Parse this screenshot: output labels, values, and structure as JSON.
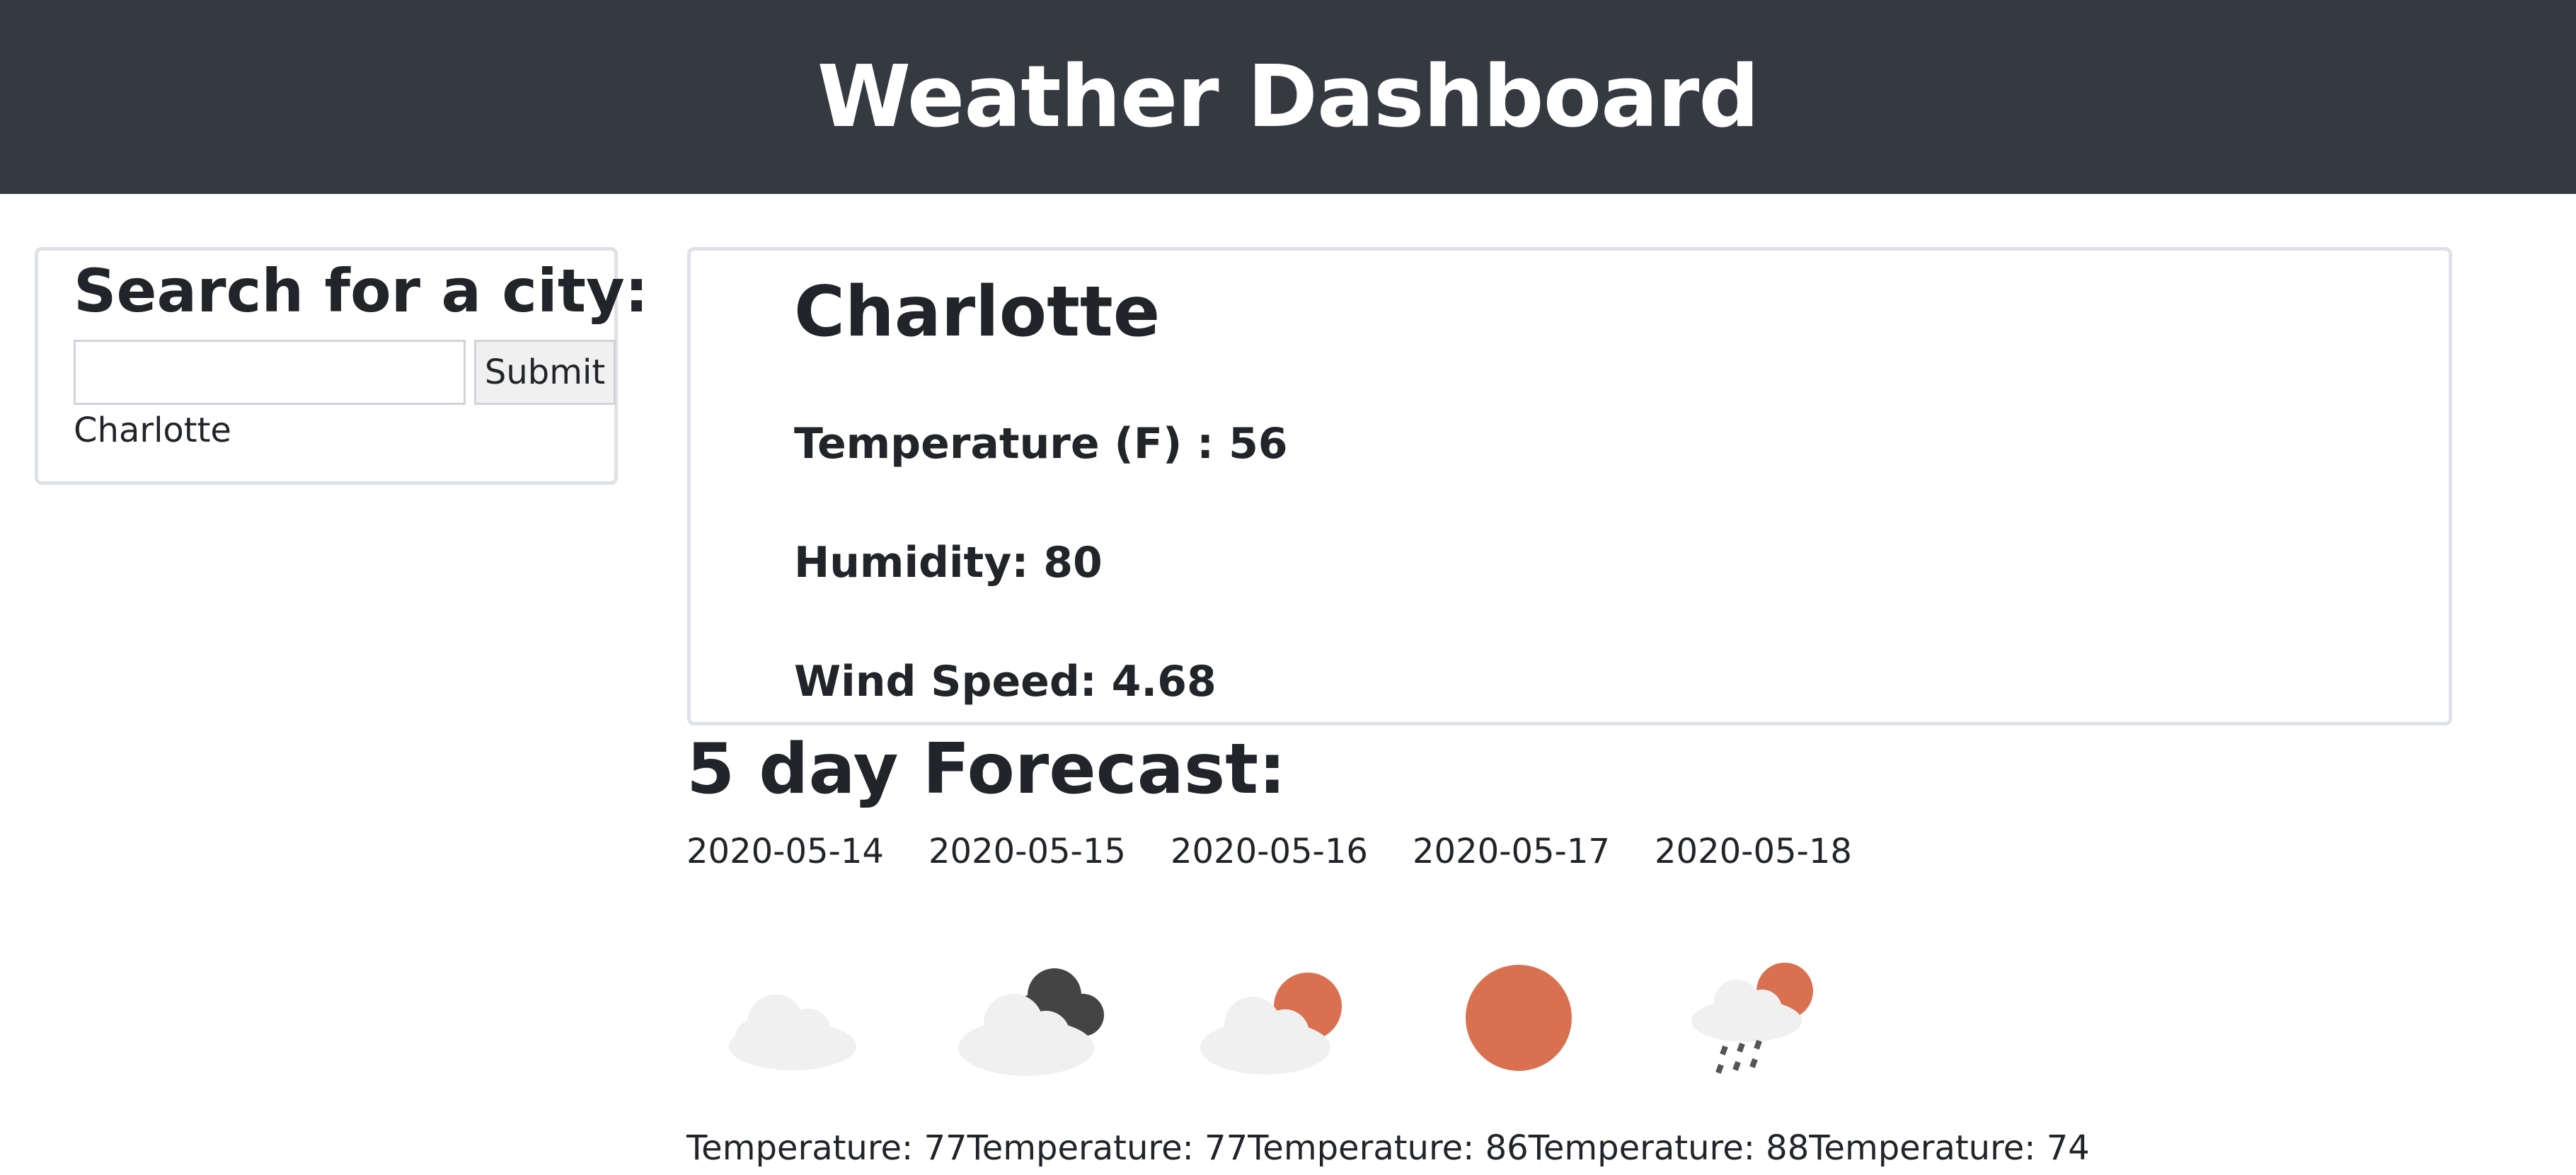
{
  "header": {
    "title": "Weather Dashboard"
  },
  "search": {
    "heading": "Search for a city:",
    "input_value": "",
    "submit_label": "Submit",
    "history": [
      "Charlotte"
    ]
  },
  "current": {
    "city": "Charlotte",
    "temperature": "Temperature (F) : 56",
    "humidity": "Humidity: 80",
    "wind_speed": "Wind Speed: 4.68"
  },
  "forecast": {
    "title": "5 day Forecast:",
    "days": [
      {
        "date": "2020-05-14",
        "icon": "cloud-icon",
        "temperature": "Temperature: 77"
      },
      {
        "date": "2020-05-15",
        "icon": "dark-cloud-icon",
        "temperature": "Temperature: 77"
      },
      {
        "date": "2020-05-16",
        "icon": "sun-behind-cloud-icon",
        "temperature": "Temperature: 86"
      },
      {
        "date": "2020-05-17",
        "icon": "sun-icon",
        "temperature": "Temperature: 88"
      },
      {
        "date": "2020-05-18",
        "icon": "rain-sun-cloud-icon",
        "temperature": "Temperature: 74"
      }
    ]
  },
  "colors": {
    "header_bg": "#343a40",
    "card_border": "#dee2e6",
    "sun": "#d97150",
    "cloud": "#eeeeee",
    "dark_cloud": "#444444"
  }
}
